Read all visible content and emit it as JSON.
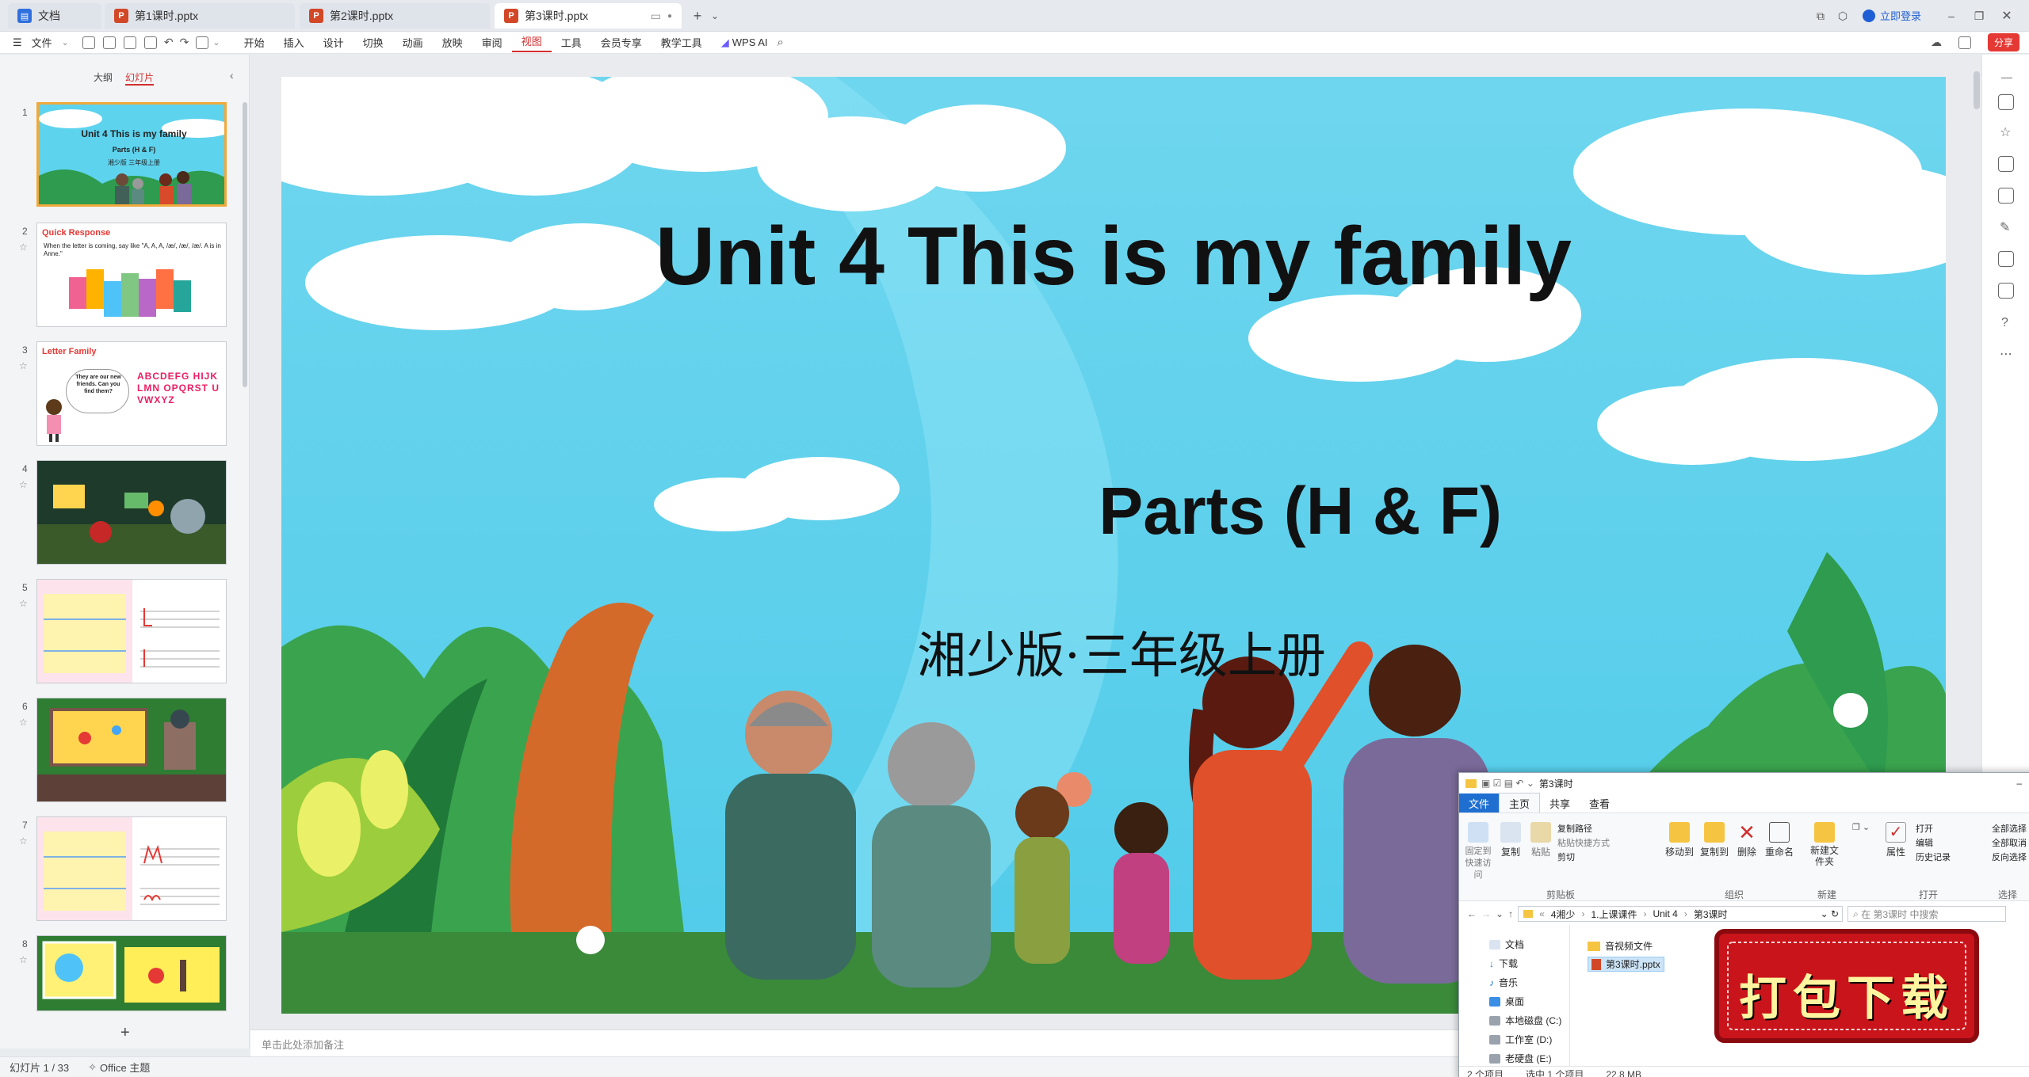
{
  "tabs": [
    {
      "label": "文档",
      "active": false
    },
    {
      "label": "第1课时.pptx",
      "active": false
    },
    {
      "label": "第2课时.pptx",
      "active": false
    },
    {
      "label": "第3课时.pptx",
      "active": true
    }
  ],
  "titlebar": {
    "login": "立即登录",
    "share": "分享"
  },
  "menu": {
    "file": "文件",
    "items": [
      "开始",
      "插入",
      "设计",
      "切换",
      "动画",
      "放映",
      "审阅",
      "视图",
      "工具",
      "会员专享",
      "教学工具"
    ],
    "active": "视图",
    "wps_ai": "WPS AI"
  },
  "panel": {
    "outline_tab": "大纲",
    "slides_tab": "幻灯片"
  },
  "thumbnails": [
    {
      "num": "1",
      "title": "Unit 4 This is my family",
      "sub": "Parts (H & F)",
      "sub2": "湘少版 三年级上册"
    },
    {
      "num": "2",
      "title": "Quick Response",
      "text": "When the letter is coming, say like \"A, A, A, /æ/, /æ/, /æ/. A is in Anne.\""
    },
    {
      "num": "3",
      "title": "Letter Family",
      "text": "They are our new friends. Can you find them?",
      "letters": "ABCDEFG HIJKLMN OPQRST UVWXYZ"
    },
    {
      "num": "4"
    },
    {
      "num": "5"
    },
    {
      "num": "6"
    },
    {
      "num": "7"
    },
    {
      "num": "8"
    }
  ],
  "slide": {
    "title": "Unit 4 This is my family",
    "subtitle": "Parts (H & F)",
    "publisher": "湘少版·三年级上册"
  },
  "notes_placeholder": "单击此处添加备注",
  "status": {
    "slide_counter": "幻灯片 1 / 33",
    "theme": "Office 主题"
  },
  "explorer": {
    "title": "第3课时",
    "ribbon_tabs": [
      "文件",
      "主页",
      "共享",
      "查看"
    ],
    "groups": {
      "clipboard": {
        "label": "剪贴板",
        "pin": "固定到快速访问",
        "copy": "复制",
        "paste": "粘贴",
        "copy_path": "复制路径",
        "paste_shortcut": "粘贴快捷方式",
        "cut": "剪切"
      },
      "organize": {
        "label": "组织",
        "move_to": "移动到",
        "copy_to": "复制到",
        "delete": "删除",
        "rename": "重命名"
      },
      "new": {
        "label": "新建",
        "new_folder": "新建文件夹"
      },
      "open": {
        "label": "打开",
        "properties": "属性",
        "open": "打开",
        "edit": "编辑",
        "history": "历史记录"
      },
      "select": {
        "label": "选择",
        "all": "全部选择",
        "none": "全部取消",
        "invert": "反向选择"
      }
    },
    "path": [
      "4湘少",
      "1.上课课件",
      "Unit 4",
      "第3课时"
    ],
    "search_placeholder": "在 第3课时 中搜索",
    "nav": [
      "文档",
      "下载",
      "音乐",
      "桌面",
      "本地磁盘 (C:)",
      "工作室 (D:)",
      "老硬盘 (E:)"
    ],
    "files": [
      "音视频文件",
      "第3课时.pptx"
    ],
    "status": {
      "items": "2 个项目",
      "selected": "选中 1 个项目",
      "size": "22.8 MB"
    }
  },
  "download_banner": "打包下载",
  "colors": {
    "accent": "#d32f2f",
    "sky": "#5ed3ee",
    "banner_red": "#c8141a"
  }
}
